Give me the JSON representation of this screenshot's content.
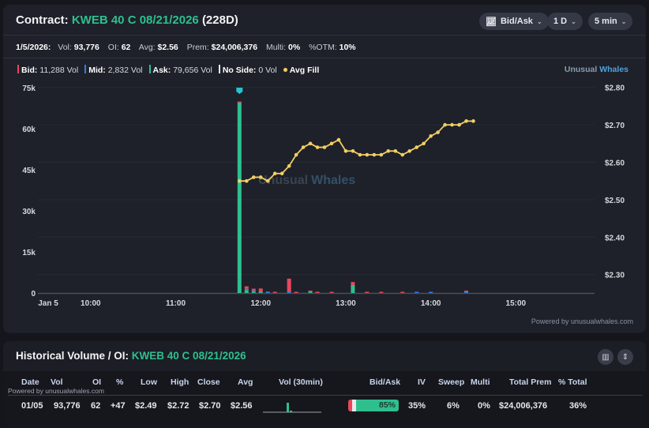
{
  "header": {
    "label": "Contract:",
    "contract": "KWEB 40 C 08/21/2026",
    "dte": "(228D)"
  },
  "controls": {
    "chart_type": "Bid/Ask",
    "range": "1 D",
    "interval": "5 min"
  },
  "stats": {
    "date": "1/5/2026:",
    "vol_label": "Vol:",
    "vol": "93,776",
    "oi_label": "OI:",
    "oi": "62",
    "avg_label": "Avg:",
    "avg": "$2.56",
    "prem_label": "Prem:",
    "prem": "$24,006,376",
    "multi_label": "Multi:",
    "multi": "0%",
    "otm_label": "%OTM:",
    "otm": "10%"
  },
  "legend": {
    "bid_label": "Bid:",
    "bid": "11,288 Vol",
    "mid_label": "Mid:",
    "mid": "2,832 Vol",
    "ask_label": "Ask:",
    "ask": "79,656 Vol",
    "noside_label": "No Side:",
    "noside": "0 Vol",
    "avg_fill": "Avg Fill"
  },
  "brand": {
    "a": "Unusual",
    "b": "Whales"
  },
  "watermark": {
    "a": "Unusual",
    "b": "Whales"
  },
  "powered": "Powered by unusualwhales.com",
  "colors": {
    "bid": "#e8475a",
    "mid": "#2f7fe8",
    "ask": "#2fbf8f",
    "noside": "#e6e8ee",
    "avg": "#f2cf63"
  },
  "chart_data": {
    "type": "bar+line",
    "left_axis": {
      "ticks": [
        "75k",
        "60k",
        "45k",
        "30k",
        "15k",
        "0"
      ],
      "range": [
        0,
        75000
      ]
    },
    "right_axis": {
      "ticks": [
        "$2.80",
        "$2.70",
        "$2.60",
        "$2.50",
        "$2.40",
        "$2.30"
      ],
      "range": [
        2.3,
        2.8
      ]
    },
    "x_ticks": [
      "Jan 5",
      "10:00",
      "11:00",
      "12:00",
      "13:00",
      "14:00",
      "15:00"
    ],
    "volume": [
      {
        "t": "11:45",
        "bid": 300,
        "mid": 0,
        "ask": 69500
      },
      {
        "t": "11:50",
        "bid": 900,
        "mid": 200,
        "ask": 1100
      },
      {
        "t": "11:55",
        "bid": 700,
        "mid": 200,
        "ask": 400
      },
      {
        "t": "12:00",
        "bid": 1200,
        "mid": 0,
        "ask": 200
      },
      {
        "t": "12:05",
        "bid": 0,
        "mid": 500,
        "ask": 0
      },
      {
        "t": "12:10",
        "bid": 200,
        "mid": 0,
        "ask": 0
      },
      {
        "t": "12:20",
        "bid": 4800,
        "mid": 200,
        "ask": 0
      },
      {
        "t": "12:25",
        "bid": 300,
        "mid": 0,
        "ask": 0
      },
      {
        "t": "12:35",
        "bid": 300,
        "mid": 0,
        "ask": 200
      },
      {
        "t": "12:40",
        "bid": 200,
        "mid": 0,
        "ask": 0
      },
      {
        "t": "12:50",
        "bid": 200,
        "mid": 0,
        "ask": 0
      },
      {
        "t": "13:05",
        "bid": 1100,
        "mid": 0,
        "ask": 2900
      },
      {
        "t": "13:15",
        "bid": 200,
        "mid": 0,
        "ask": 0
      },
      {
        "t": "13:25",
        "bid": 150,
        "mid": 0,
        "ask": 0
      },
      {
        "t": "13:40",
        "bid": 200,
        "mid": 0,
        "ask": 0
      },
      {
        "t": "13:50",
        "bid": 0,
        "mid": 150,
        "ask": 0
      },
      {
        "t": "14:00",
        "bid": 0,
        "mid": 100,
        "ask": 0
      },
      {
        "t": "14:25",
        "bid": 200,
        "mid": 400,
        "ask": 0
      }
    ],
    "avg_fill": {
      "start": "11:45",
      "step_min": 5,
      "values": [
        2.55,
        2.55,
        2.56,
        2.56,
        2.55,
        2.57,
        2.57,
        2.59,
        2.62,
        2.64,
        2.65,
        2.64,
        2.64,
        2.65,
        2.66,
        2.63,
        2.63,
        2.62,
        2.62,
        2.62,
        2.62,
        2.63,
        2.63,
        2.62,
        2.63,
        2.64,
        2.65,
        2.67,
        2.68,
        2.7,
        2.7,
        2.7,
        2.71,
        2.71
      ]
    }
  },
  "history": {
    "title": "Historical Volume / OI:",
    "contract": "KWEB 40 C 08/21/2026",
    "columns": [
      "Date",
      "Vol",
      "OI",
      "%",
      "Low",
      "High",
      "Close",
      "Avg",
      "Vol (30min)",
      "Bid/Ask",
      "IV",
      "Sweep",
      "Multi",
      "Total Prem",
      "% Total"
    ],
    "row": {
      "date": "01/05",
      "vol": "93,776",
      "oi": "62",
      "chg": "+47",
      "low": "$2.49",
      "high": "$2.72",
      "close": "$2.70",
      "avg": "$2.56",
      "ask_pct_label": "85%",
      "ask_pct": 85,
      "bid_pct": 8,
      "iv": "35%",
      "sweep": "6%",
      "multi": "0%",
      "prem": "$24,006,376",
      "pct_total": "36%"
    }
  }
}
